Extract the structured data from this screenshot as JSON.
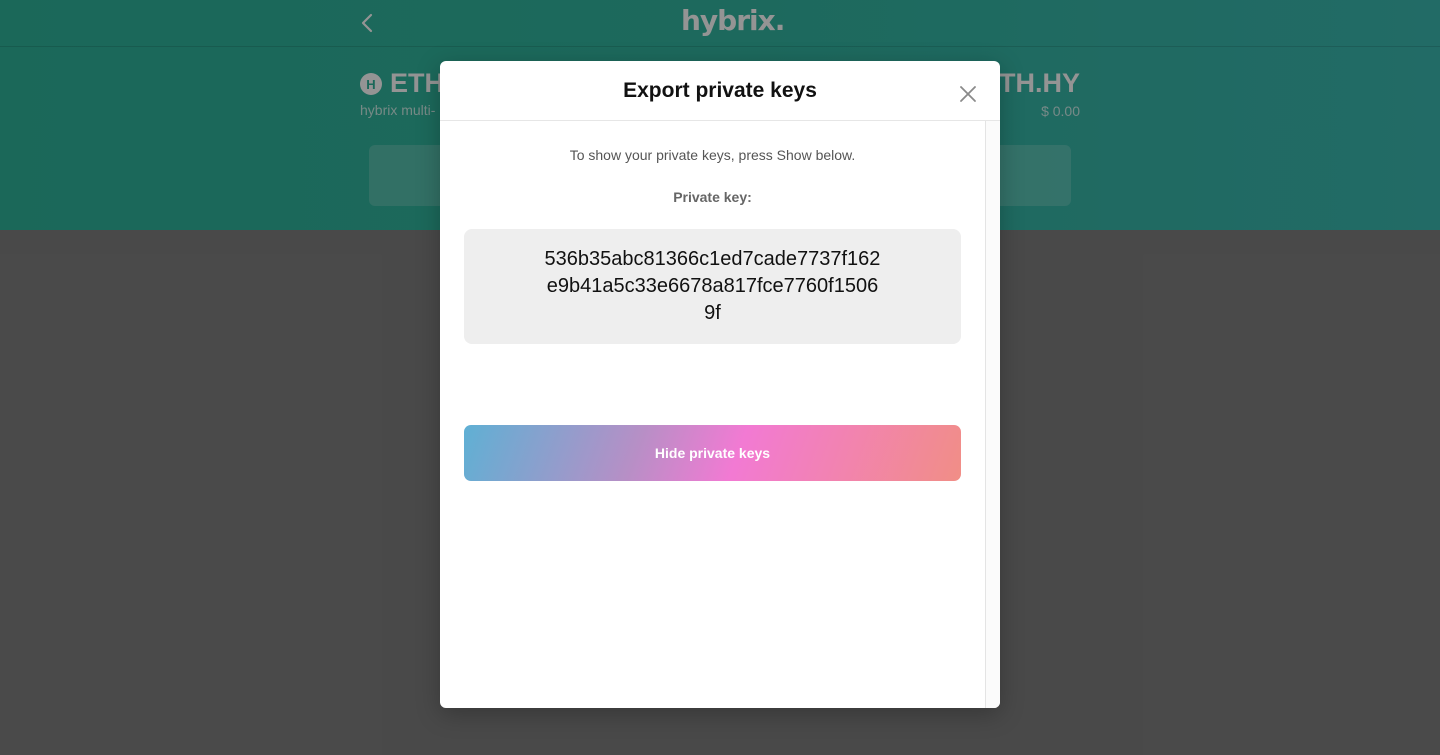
{
  "app": {
    "logo_text": "hybrix.",
    "asset": {
      "coin_icon_letter": "H",
      "symbol": "ETH.",
      "description": "hybrix multi-",
      "symbol_right": "ETH.HY",
      "balance": "$ 0.00"
    }
  },
  "modal": {
    "title": "Export private keys",
    "instructions": "To show your private keys, press Show below.",
    "key_label": "Private key:",
    "private_key": "536b35abc81366c1ed7cade7737f162e9b41a5c33e6678a817fce7760f15069f",
    "hide_button_label": "Hide private keys"
  },
  "colors": {
    "header_green": "#2fb39a",
    "overlay": "#4a4a4a",
    "key_box": "#eeeeee",
    "button_gradient": [
      "#5fb0d4",
      "#f27ad3",
      "#f18e86"
    ]
  },
  "icons": {
    "back": "chevron-left-icon",
    "close": "close-icon",
    "coin": "hybrix-coin-icon"
  }
}
